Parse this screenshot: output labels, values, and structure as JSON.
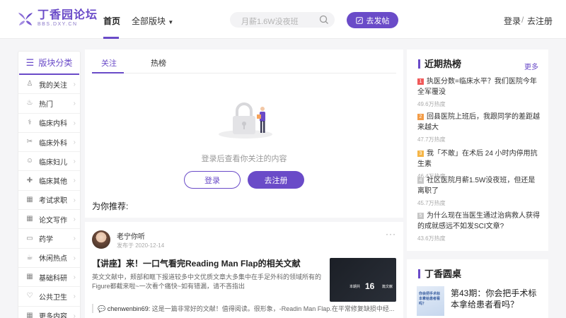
{
  "header": {
    "logo_name": "丁香园论坛",
    "logo_sub": "BBS.DXY.CN",
    "nav_home": "首页",
    "nav_all": "全部版块",
    "search_placeholder": "月薪1.6W没夜班",
    "post_button": "去发帖",
    "login": "登录",
    "separator": "/",
    "register": "去注册"
  },
  "sidebar": {
    "title": "版块分类",
    "items": [
      {
        "label": "我的关注",
        "icon": "user-icon"
      },
      {
        "label": "热门",
        "icon": "flame-icon"
      },
      {
        "label": "临床内科",
        "icon": "stethoscope-icon"
      },
      {
        "label": "临床外科",
        "icon": "scissors-icon"
      },
      {
        "label": "临床妇儿",
        "icon": "baby-icon"
      },
      {
        "label": "临床其他",
        "icon": "clinic-icon"
      },
      {
        "label": "考试求职",
        "icon": "grid-icon"
      },
      {
        "label": "论文写作",
        "icon": "grid-icon"
      },
      {
        "label": "药学",
        "icon": "pill-icon"
      },
      {
        "label": "休闲热点",
        "icon": "cup-icon"
      },
      {
        "label": "基础科研",
        "icon": "grid-icon"
      },
      {
        "label": "公共卫生",
        "icon": "heart-shield-icon"
      },
      {
        "label": "更多内容",
        "icon": "grid-icon"
      }
    ]
  },
  "main": {
    "tabs": [
      "关注",
      "热榜"
    ],
    "empty_text": "登录后查看你关注的内容",
    "login_button": "登录",
    "register_button": "去注册",
    "recommend_title": "为你推荐:",
    "post": {
      "author": "老宁你听",
      "date": "发布于 2020-12-14",
      "title": "【讲座】来！一口气看完Reading Man Flap的相关文献",
      "excerpt": "英文文献中，颊部和眶下报道较多中文优质文章大多集中在手足外科的领域所有的Figure都截来啦~一次看个痛快~如有错漏，请不吝指出",
      "thumb_left": "本期共",
      "thumb_number": "16",
      "thumb_right": "篇文献",
      "comment_user": "chenwenbin69:",
      "comment_text": " 这是一篇非常好的文献！值得阅读。很形象，-Readin Man Flap.在平常修复缺损中经..."
    }
  },
  "hot": {
    "title": "近期热榜",
    "more": "更多",
    "items": [
      {
        "rank": "1",
        "title": "执医分数=临床水平？我们医院今年全军覆没",
        "heat": "49.6万热度",
        "color": "#f05a5a"
      },
      {
        "rank": "2",
        "title": "回县医院上班后，我跟同学的差距越来越大",
        "heat": "47.7万热度",
        "color": "#f39c47"
      },
      {
        "rank": "3",
        "title": "我「不敢」在术后 24 小时内停用抗生素",
        "heat": "46.4万热度",
        "color": "#f5b547"
      },
      {
        "rank": "4",
        "title": "社区医院月薪1.5W没夜班，但还是离职了",
        "heat": "45.7万热度",
        "color": "#c7c7c7"
      },
      {
        "rank": "5",
        "title": "为什么现在当医生通过治病救人获得的成就感远不如发SCI文章?",
        "heat": "43.6万热度",
        "color": "#c7c7c7"
      }
    ]
  },
  "dingxiang": {
    "title": "丁香圆桌",
    "episode_title": "第43期：你会把手术标本拿给患者看吗？",
    "thumb_text": "你会把手术标本拿给患者看吗？"
  }
}
